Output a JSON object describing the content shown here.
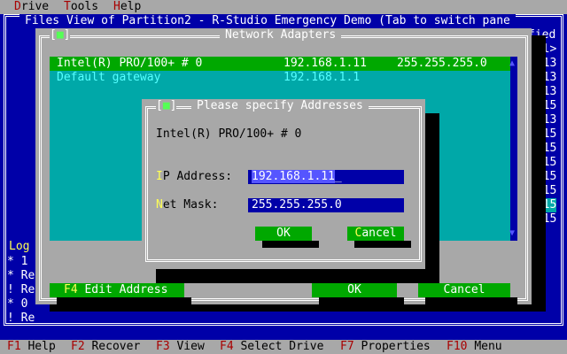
{
  "menu": {
    "items": [
      {
        "hot": "D",
        "rest": "rive"
      },
      {
        "hot": "T",
        "rest": "ools"
      },
      {
        "hot": "H",
        "rest": "elp"
      }
    ]
  },
  "window": {
    "title": "Files View of Partition2 - R-Studio Emergency Demo (Tab to switch pane",
    "right_header": "fied",
    "right_col": [
      "vel>",
      "2.13",
      "2.13",
      "2.13",
      "2.15",
      "2.13",
      "2.15",
      "2.15",
      "2.15",
      "2.15",
      "2.15",
      "2.15",
      "2.15"
    ]
  },
  "log": {
    "title": "Log",
    "lines": [
      {
        "mark": "*",
        "text": "1"
      },
      {
        "mark": "*",
        "text": "Re"
      },
      {
        "mark": "!",
        "text": "Re"
      },
      {
        "mark": "*",
        "text": "0"
      },
      {
        "mark": "!",
        "text": "Re"
      }
    ]
  },
  "network_dialog": {
    "title": "Network Adapters",
    "close_glyph": "■",
    "adapters": [
      {
        "name": "Intel(R) PRO/100+ # 0",
        "ip": "192.168.1.11",
        "mask": "255.255.255.0"
      }
    ],
    "gateway": {
      "label": "Default gateway",
      "ip": "192.168.1.1"
    },
    "buttons": {
      "edit": {
        "key": "F4",
        "label": "Edit Address"
      },
      "ok": "OK",
      "cancel": "Cancel"
    }
  },
  "address_dialog": {
    "title": "Please specify Addresses",
    "close_glyph": "■",
    "adapter_name": "Intel(R) PRO/100+ # 0",
    "ip_label_hot": "I",
    "ip_label_rest": "P Address:",
    "ip_value": "192.168.1.11",
    "mask_label_hot": "N",
    "mask_label_rest": "et Mask:",
    "mask_value": "255.255.255.0",
    "ok": "OK",
    "cancel_hot": "C",
    "cancel_rest": "ancel"
  },
  "statusbar": {
    "keys": [
      {
        "key": "F1",
        "label": "Help"
      },
      {
        "key": "F2",
        "label": "Recover"
      },
      {
        "key": "F3",
        "label": "View"
      },
      {
        "key": "F4",
        "label": "Select Drive"
      },
      {
        "key": "F7",
        "label": "Properties"
      },
      {
        "key": "F10",
        "label": "Menu"
      }
    ]
  },
  "colors": {
    "desktop": "#0000a8",
    "dialog": "#a8a8a8",
    "button": "#00a800",
    "list": "#00a8a8",
    "hotkey": "#a80000"
  }
}
